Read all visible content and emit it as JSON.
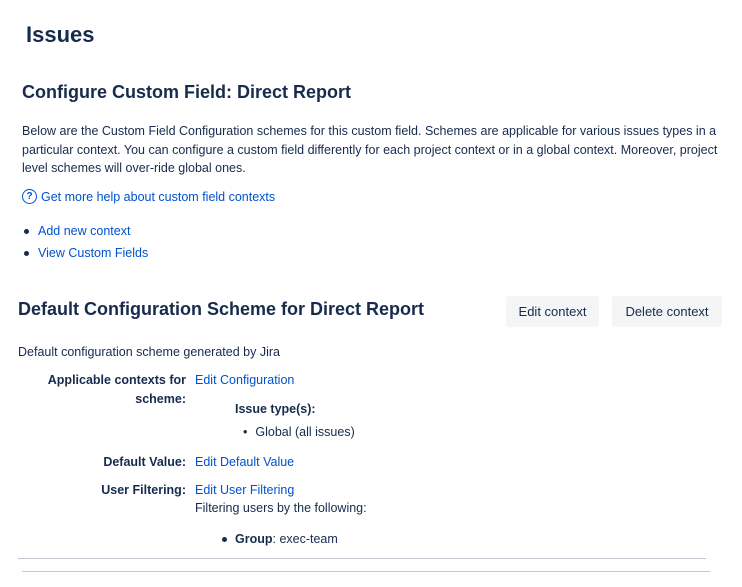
{
  "page": {
    "title": "Issues"
  },
  "config": {
    "title": "Configure Custom Field: Direct Report",
    "description": "Below are the Custom Field Configuration schemes for this custom field. Schemes are applicable for various issues types in a particular context. You can configure a custom field differently for each project context or in a global context. Moreover, project level schemes will over-ride global ones.",
    "help_icon": "question-circle-icon",
    "help_link": "Get more help about custom field contexts",
    "links": [
      "Add new context",
      "View Custom Fields"
    ]
  },
  "scheme": {
    "title": "Default Configuration Scheme for Direct Report",
    "edit_button": "Edit context",
    "delete_button": "Delete context",
    "description": "Default configuration scheme generated by Jira",
    "applicable_label": "Applicable contexts for scheme:",
    "edit_configuration": "Edit Configuration",
    "issue_types_label": "Issue type(s):",
    "issue_types": [
      "Global (all issues)"
    ],
    "default_value_label": "Default Value:",
    "edit_default_value": "Edit Default Value",
    "user_filtering_label": "User Filtering:",
    "edit_user_filtering": "Edit User Filtering",
    "filtering_desc": "Filtering users by the following:",
    "group_label": "Group",
    "group_value": ": exec-team"
  }
}
